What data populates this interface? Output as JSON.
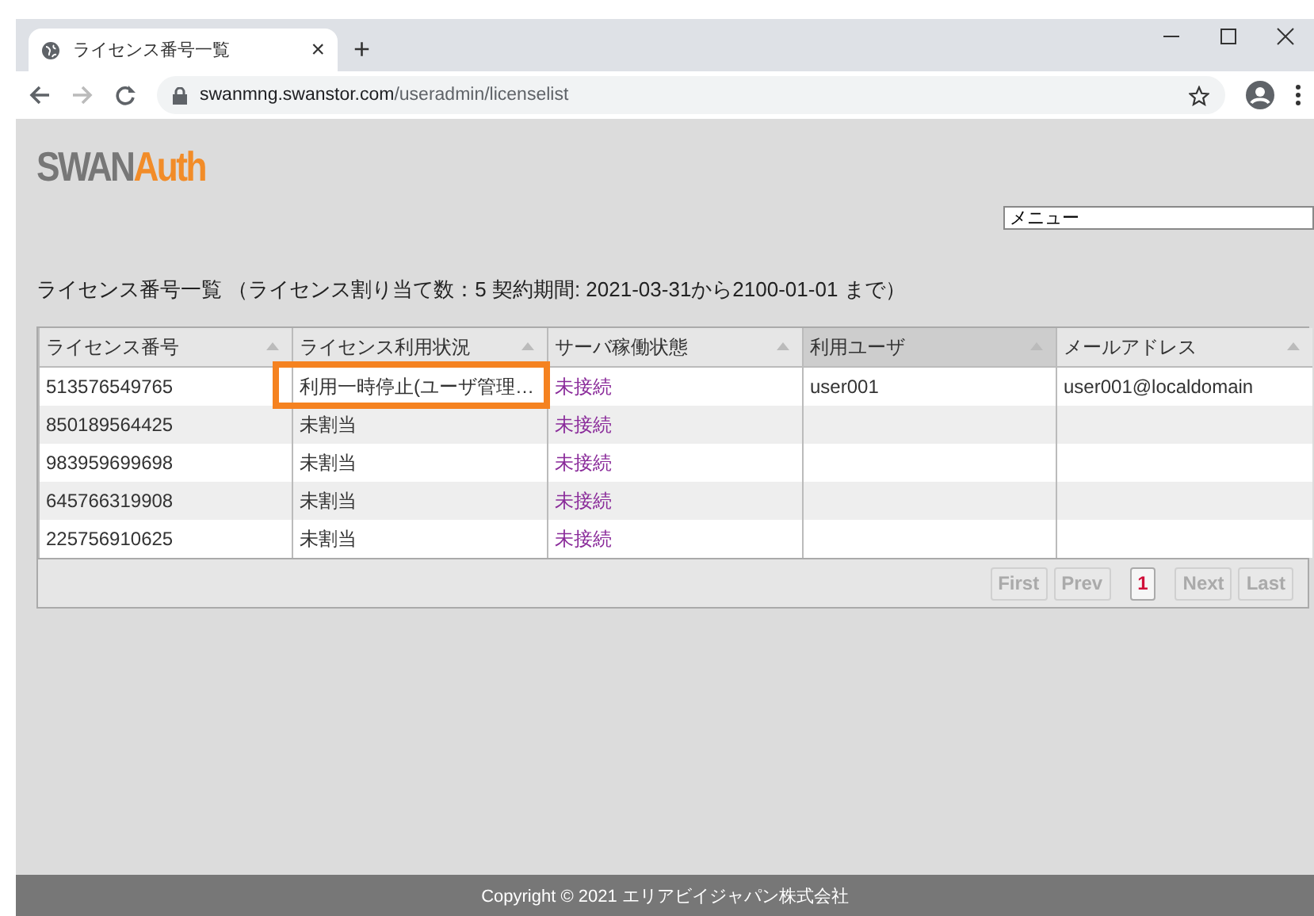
{
  "browser": {
    "tab_title": "ライセンス番号一覧",
    "tab_close": "×",
    "new_tab": "+",
    "url_host": "swanmng.swanstor.com",
    "url_path": "/useradmin/licenselist"
  },
  "logo": {
    "part_1": "SWAN",
    "part_2": "Auth"
  },
  "menu": {
    "value": "メニュー"
  },
  "heading": "ライセンス番号一覧 （ライセンス割り当て数：5 契約期間: 2021-03-31から2100-01-01 まで）",
  "table": {
    "columns": [
      {
        "label": "ライセンス番号",
        "sorted": false
      },
      {
        "label": "ライセンス利用状況",
        "sorted": false
      },
      {
        "label": "サーバ稼働状態",
        "sorted": false
      },
      {
        "label": "利用ユーザ",
        "sorted": true
      },
      {
        "label": "メールアドレス",
        "sorted": false
      }
    ],
    "rows": [
      {
        "license": "513576549765",
        "usage": "利用一時停止(ユーザ管理…",
        "usage_highlighted": true,
        "server": "未接続",
        "user": "user001",
        "email": "user001@localdomain"
      },
      {
        "license": "850189564425",
        "usage": "未割当",
        "usage_highlighted": false,
        "server": "未接続"
      },
      {
        "license": "983959699698",
        "usage": "未割当",
        "usage_highlighted": false,
        "server": "未接続"
      },
      {
        "license": "645766319908",
        "usage": "未割当",
        "usage_highlighted": false,
        "server": "未接続"
      },
      {
        "license": "225756910625",
        "usage": "未割当",
        "usage_highlighted": false,
        "server": "未接続"
      }
    ]
  },
  "pagination": [
    {
      "label": "First",
      "kind": "nav",
      "disabled": true
    },
    {
      "label": "Prev",
      "kind": "nav",
      "disabled": true
    },
    {
      "label": "1",
      "kind": "page",
      "selected": true
    },
    {
      "label": "Next",
      "kind": "nav",
      "disabled": true
    },
    {
      "label": "Last",
      "kind": "nav",
      "disabled": true
    }
  ],
  "footer": "Copyright © 2021 エリアビイジャパン株式会社"
}
